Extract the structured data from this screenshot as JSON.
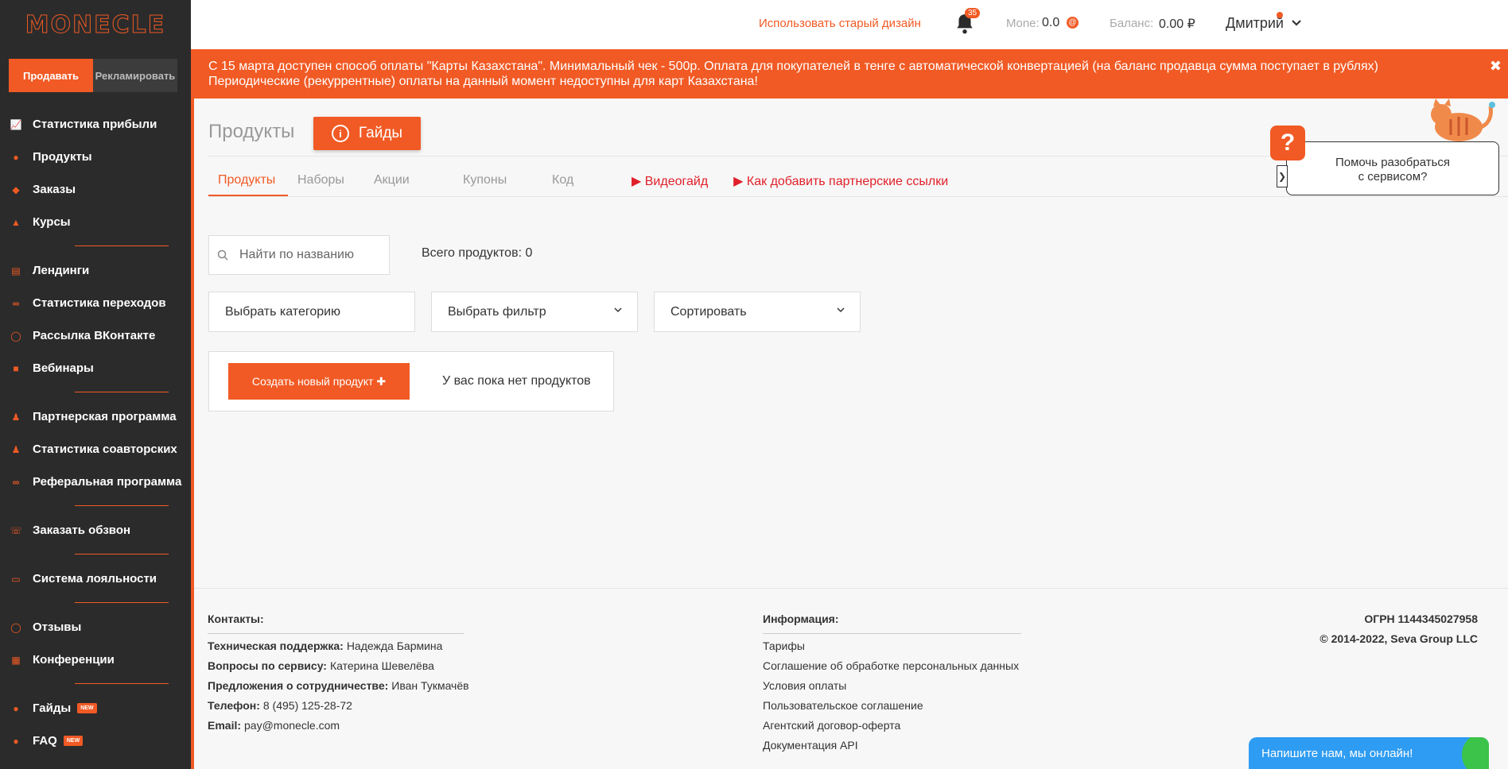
{
  "sidebar": {
    "logo": "MONECLE",
    "mode_sell": "Продавать",
    "mode_advertise": "Рекламировать",
    "groups": [
      [
        {
          "label": "Статистика прибыли",
          "icon": "chart-line-icon"
        },
        {
          "label": "Продукты",
          "icon": "products-icon"
        },
        {
          "label": "Заказы",
          "icon": "tag-icon"
        },
        {
          "label": "Курсы",
          "icon": "graduation-cap-icon"
        }
      ],
      [
        {
          "label": "Лендинги",
          "icon": "document-icon"
        },
        {
          "label": "Статистика переходов",
          "icon": "link-icon"
        },
        {
          "label": "Рассылка ВКонтакте",
          "icon": "chat-icon"
        },
        {
          "label": "Вебинары",
          "icon": "video-camera-icon"
        }
      ],
      [
        {
          "label": "Партнерская программа",
          "icon": "user-plus-icon"
        },
        {
          "label": "Статистика соавторских",
          "icon": "users-icon"
        },
        {
          "label": "Реферальная программа",
          "icon": "link-icon"
        }
      ],
      [
        {
          "label": "Заказать обзвон",
          "icon": "phone-icon"
        }
      ],
      [
        {
          "label": "Система лояльности",
          "icon": "money-icon"
        }
      ],
      [
        {
          "label": "Отзывы",
          "icon": "comments-icon"
        },
        {
          "label": "Конференции",
          "icon": "calendar-icon"
        }
      ],
      [
        {
          "label": "Гайды",
          "icon": "info-circle-icon",
          "badge": "NEW"
        },
        {
          "label": "FAQ",
          "icon": "question-icon",
          "badge": "NEW"
        }
      ]
    ]
  },
  "topbar": {
    "old_design_link": "Использовать старый дизайн",
    "notification_count": "35",
    "money_label": "Mone:",
    "money_value": "0.0",
    "coin_symbol": "@",
    "balance_label": "Баланс:",
    "balance_value": "0.00 ₽",
    "user_name": "Дмитрий"
  },
  "banner": {
    "line1": "С 15 марта доступен способ оплаты \"Карты Казахстана\". Минимальный чек - 500р. Оплата для покупателей в тенге с автоматической конвертацией (на баланс продавца сумма поступает в рублях)",
    "line2": "Периодические (рекуррентные) оплаты на данный момент недоступны для карт Казахстана!",
    "close": "✖"
  },
  "main": {
    "title": "Продукты",
    "guides_button": "Гайды",
    "tabs": [
      {
        "label": "Продукты",
        "active": true
      },
      {
        "label": "Наборы"
      },
      {
        "label": "Акции"
      },
      {
        "label": "Купоны"
      },
      {
        "label": "Код"
      },
      {
        "label": "▶ Видеогайд",
        "red": true
      },
      {
        "label": "▶ Как добавить партнерские ссылки",
        "red": true
      }
    ],
    "search_placeholder": "Найти по названию",
    "total_products": "Всего продуктов: 0",
    "category_select": "Выбрать категорию",
    "filter_select": "Выбрать фильтр",
    "sort_select": "Сортировать",
    "create_button": "Создать новый продукт ✚",
    "empty_text": "У вас пока нет продуктов"
  },
  "help": {
    "question_mark": "?",
    "bubble_line1": "Помочь разобраться",
    "bubble_line2": "с сервисом?",
    "arrow": "❯"
  },
  "footer": {
    "contacts_heading": "Контакты:",
    "contacts": [
      {
        "label": "Техническая поддержка:",
        "value": "Надежда Бармина"
      },
      {
        "label": "Вопросы по сервису:",
        "value": "Катерина Шевелёва"
      },
      {
        "label": "Предложения о сотрудничестве:",
        "value": "Иван Тукмачёв"
      },
      {
        "label": "Телефон:",
        "value": "8 (495) 125-28-72"
      },
      {
        "label": "Email:",
        "value": "pay@monecle.com"
      }
    ],
    "info_heading": "Информация:",
    "info_links": [
      "Тарифы",
      "Соглашение об обработке персональных данных",
      "Условия оплаты",
      "Пользовательское соглашение",
      "Агентский договор-оферта",
      "Документация API"
    ],
    "ogrn": "ОГРН 1144345027958",
    "copyright": "© 2014-2022, Seva Group LLC"
  },
  "chat": {
    "label": "Напишите нам, мы онлайн!"
  },
  "colors": {
    "accent": "#f15a24",
    "sidebar_bg": "#2b2b2b",
    "chat_blue": "#2e9cf2",
    "chat_green": "#3cc34a"
  }
}
